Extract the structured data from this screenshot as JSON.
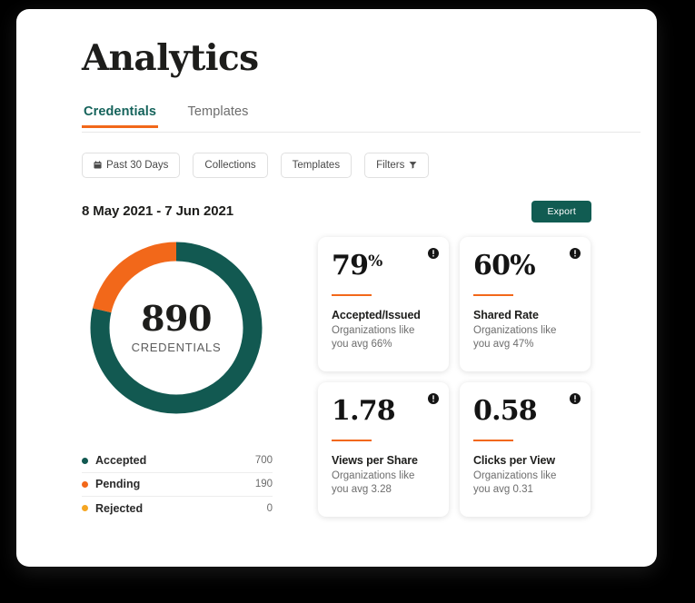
{
  "header": {
    "title": "Analytics"
  },
  "tabs": [
    {
      "label": "Credentials",
      "active": true
    },
    {
      "label": "Templates",
      "active": false
    }
  ],
  "filters": [
    {
      "label": "Past 30 Days",
      "icon": "calendar-icon"
    },
    {
      "label": "Collections",
      "icon": ""
    },
    {
      "label": "Templates",
      "icon": ""
    },
    {
      "label": "Filters",
      "icon": "filter-icon"
    }
  ],
  "date_range": "8 May 2021 - 7 Jun 2021",
  "export_label": "Export",
  "chart_data": {
    "type": "pie",
    "title": "",
    "center_value": "890",
    "center_label": "CREDENTIALS",
    "total": 890,
    "categories": [
      "Accepted",
      "Pending",
      "Rejected"
    ],
    "values": [
      700,
      190,
      0
    ],
    "colors": [
      "#125951",
      "#f2681a",
      "#f5a623"
    ],
    "legend_position": "bottom",
    "donut": true
  },
  "legend": [
    {
      "label": "Accepted",
      "value": "700",
      "color": "#125951"
    },
    {
      "label": "Pending",
      "value": "190",
      "color": "#f2681a"
    },
    {
      "label": "Rejected",
      "value": "0",
      "color": "#f5a623"
    }
  ],
  "stat_cards": [
    {
      "value": "79",
      "suffix": "%",
      "suffix_size": "small",
      "title": "Accepted/Issued",
      "subtitle": "Organizations like you avg 66%",
      "info_icon": "info-icon"
    },
    {
      "value": "60",
      "suffix": "%",
      "suffix_size": "large",
      "title": "Shared Rate",
      "subtitle": "Organizations like you avg 47%",
      "info_icon": "info-icon"
    },
    {
      "value": "1.78",
      "suffix": "",
      "suffix_size": "none",
      "title": "Views per Share",
      "subtitle": "Organizations like you avg 3.28",
      "info_icon": "info-icon"
    },
    {
      "value": "0.58",
      "suffix": "",
      "suffix_size": "none",
      "title": "Clicks per View",
      "subtitle": "Organizations like you avg 0.31",
      "info_icon": "info-icon"
    }
  ],
  "colors": {
    "teal": "#125951",
    "orange": "#f2681a",
    "amber": "#f5a623",
    "tab_active": "#15635b",
    "export_bg": "#115c52"
  }
}
